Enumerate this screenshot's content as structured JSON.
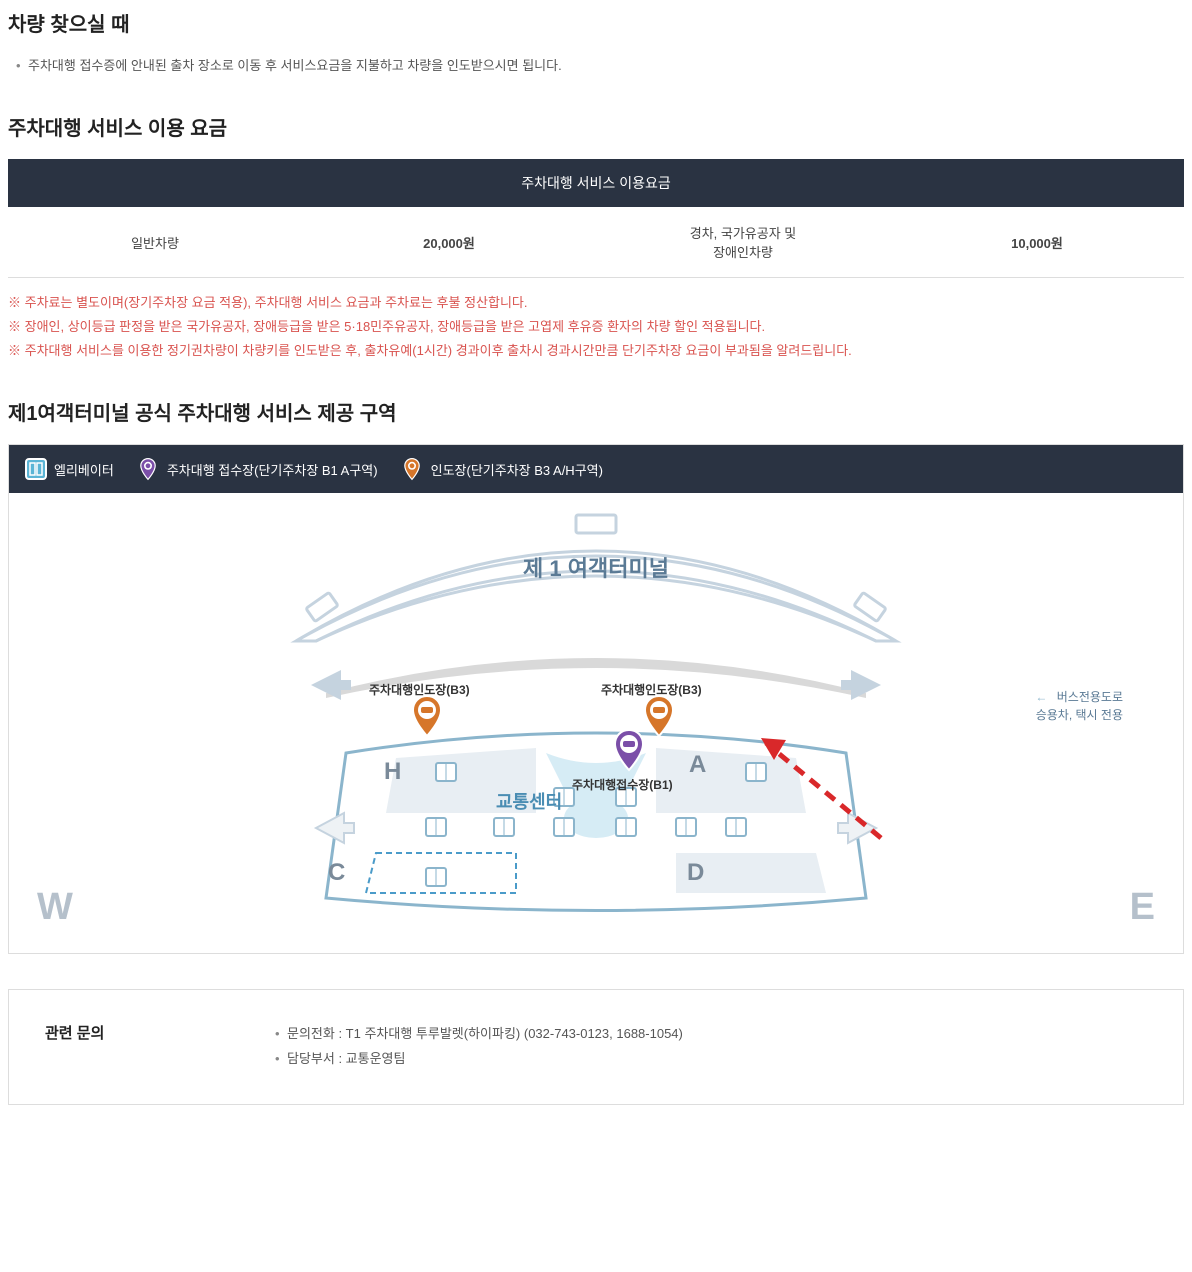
{
  "sections": {
    "pickup": {
      "title": "차량 찾으실 때",
      "items": [
        "주차대행 접수증에 안내된 출차 장소로 이동 후 서비스요금을 지불하고 차량을 인도받으시면 됩니다."
      ]
    },
    "fees": {
      "title": "주차대행 서비스 이용 요금",
      "tableHeader": "주차대행 서비스 이용요금",
      "rows": [
        {
          "label": "일반차량",
          "price": "20,000원"
        },
        {
          "label": "경차, 국가유공자 및\n장애인차량",
          "price": "10,000원"
        }
      ],
      "notices": [
        "※ 주차료는 별도이며(장기주차장 요금 적용), 주차대행 서비스 요금과 주차료는 후불 정산합니다.",
        "※ 장애인, 상이등급 판정을 받은 국가유공자, 장애등급을 받은 5·18민주유공자, 장애등급을 받은 고엽제 후유증 환자의 차량 할인 적용됩니다.",
        "※ 주차대행 서비스를 이용한 정기권차량이 차량키를 인도받은 후, 출차유예(1시간) 경과이후 출차시 경과시간만큼 단기주차장 요금이 부과됨을 알려드립니다."
      ]
    },
    "mapArea": {
      "title": "제1여객터미널 공식 주차대행 서비스 제공 구역",
      "legend": {
        "elevator": "엘리베이터",
        "reception": "주차대행 접수장(단기주차장 B1 A구역)",
        "delivery": "인도장(단기주차장 B3 A/H구역)"
      },
      "map": {
        "terminalLabel": "제 1 여객터미널",
        "deliveryB3_h": "주차대행인도장(B3)",
        "deliveryB3_a": "주차대행인도장(B3)",
        "receptionB1": "주차대행접수장(B1)",
        "trafficCenter": "교통센터",
        "busLane1": "버스전용도로",
        "busLane2": "승용차, 택시 전용",
        "areaH": "H",
        "areaA": "A",
        "areaC": "C",
        "areaD": "D",
        "sideW": "W",
        "sideE": "E"
      }
    },
    "contact": {
      "title": "관련 문의",
      "items": [
        "문의전화 : T1 주차대행 투루발렛(하이파킹) (032-743-0123, 1688-1054)",
        "담당부서 : 교통운영팀"
      ]
    }
  }
}
